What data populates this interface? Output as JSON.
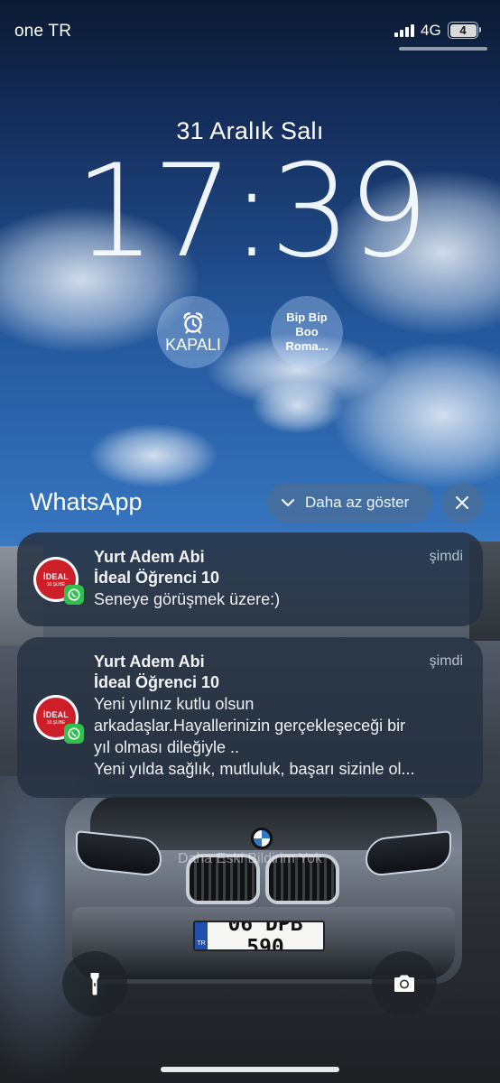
{
  "status_bar": {
    "carrier": "one TR",
    "network": "4G",
    "battery": "4"
  },
  "lock_screen": {
    "date": "31 Aralık Salı",
    "time": "17:39",
    "widgets": {
      "alarm": {
        "icon": "alarm-clock-icon",
        "label": "KAPALI"
      },
      "music": {
        "label": "Bip Bip Boo Roma..."
      }
    }
  },
  "notifications_header": {
    "app_name": "WhatsApp",
    "show_less_label": "Daha az göster"
  },
  "notifications": [
    {
      "sender": "Yurt Adem Abi",
      "group": "İdeal Öğrenci  10",
      "time": "şimdi",
      "body": "Seneye görüşmek üzere:)",
      "icon": {
        "brand": "İDEAL",
        "branch": "10.ŞUBE"
      }
    },
    {
      "sender": "Yurt Adem Abi",
      "group": "İdeal Öğrenci  10",
      "time": "şimdi",
      "body_lines": [
        "Yeni yılınız kutlu olsun",
        "arkadaşlar.Hayallerinizin gerçekleşeceği bir",
        "yıl olması dileğiyle ..",
        "Yeni yılda sağlık, mutluluk, başarı sizinle ol..."
      ],
      "icon": {
        "brand": "İDEAL",
        "branch": "10.ŞUBE"
      }
    }
  ],
  "no_older_notifications": "Daha Eski Bildirim Yok",
  "wallpaper": {
    "license_plate": {
      "country": "TR",
      "number": "06 DPB 590"
    }
  },
  "quick_actions": {
    "flashlight": "flashlight-icon",
    "camera": "camera-icon"
  },
  "colors": {
    "whatsapp_green": "#2fc04d",
    "ideal_red": "#cc1f2a",
    "notification_bg": "#263242"
  }
}
